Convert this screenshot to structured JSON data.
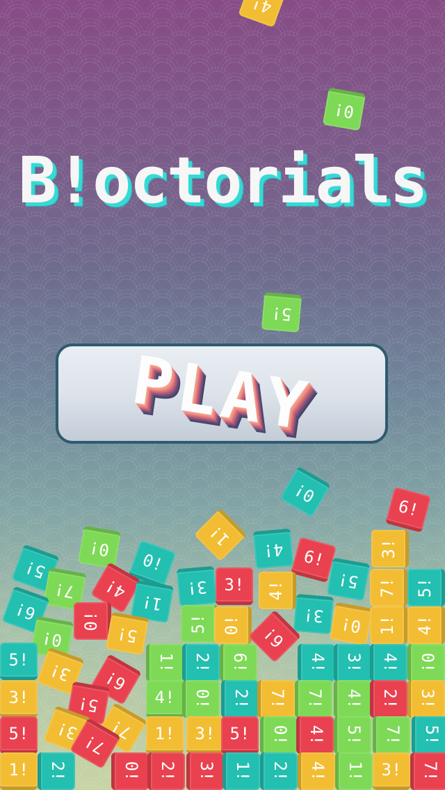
{
  "title": "B!octorials",
  "play_label": "PLAY",
  "colors": {
    "green": "#7ed957",
    "teal": "#23bfb1",
    "yellow": "#f2bd33",
    "red": "#e9414f",
    "play_border": "#2e5b6e"
  },
  "blocks": [
    {
      "label": "4!",
      "color": "green"
    },
    {
      "label": "0!",
      "color": "green"
    },
    {
      "label": "5!",
      "color": "green"
    },
    {
      "label": "0!",
      "color": "teal"
    },
    {
      "label": "6!",
      "color": "red"
    },
    {
      "label": "1!",
      "color": "yellow"
    },
    {
      "label": "0!",
      "color": "green"
    },
    {
      "label": "0!",
      "color": "teal"
    },
    {
      "label": "4!",
      "color": "teal"
    },
    {
      "label": "6!",
      "color": "red"
    },
    {
      "label": "3!",
      "color": "yellow"
    },
    {
      "label": "5!",
      "color": "teal"
    },
    {
      "label": "7!",
      "color": "green"
    },
    {
      "label": "4!",
      "color": "red"
    },
    {
      "label": "5!",
      "color": "teal"
    },
    {
      "label": "3!",
      "color": "teal"
    },
    {
      "label": "3!",
      "color": "red"
    },
    {
      "label": "4!",
      "color": "yellow"
    },
    {
      "label": "7!",
      "color": "yellow"
    },
    {
      "label": "5!",
      "color": "teal"
    },
    {
      "label": "6!",
      "color": "teal"
    },
    {
      "label": "1!",
      "color": "teal"
    },
    {
      "label": "0!",
      "color": "red"
    },
    {
      "label": "3!",
      "color": "teal"
    },
    {
      "label": "0!",
      "color": "yellow"
    },
    {
      "label": "1!",
      "color": "yellow"
    },
    {
      "label": "4!",
      "color": "yellow"
    },
    {
      "label": "0!",
      "color": "green"
    },
    {
      "label": "5!",
      "color": "yellow"
    },
    {
      "label": "5!",
      "color": "green"
    },
    {
      "label": "0!",
      "color": "yellow"
    },
    {
      "label": "6!",
      "color": "red"
    },
    {
      "label": "5!",
      "color": "teal"
    },
    {
      "label": "1!",
      "color": "green"
    },
    {
      "label": "2!",
      "color": "teal"
    },
    {
      "label": "6!",
      "color": "green"
    },
    {
      "label": "4!",
      "color": "teal"
    },
    {
      "label": "3!",
      "color": "teal"
    },
    {
      "label": "4!",
      "color": "teal"
    },
    {
      "label": "0!",
      "color": "green"
    },
    {
      "label": "3!",
      "color": "yellow"
    },
    {
      "label": "6!",
      "color": "red"
    },
    {
      "label": "4!",
      "color": "green"
    },
    {
      "label": "0!",
      "color": "green"
    },
    {
      "label": "2!",
      "color": "teal"
    },
    {
      "label": "7!",
      "color": "yellow"
    },
    {
      "label": "7!",
      "color": "green"
    },
    {
      "label": "4!",
      "color": "green"
    },
    {
      "label": "2!",
      "color": "red"
    },
    {
      "label": "3!",
      "color": "yellow"
    },
    {
      "label": "3!",
      "color": "yellow"
    },
    {
      "label": "5!",
      "color": "red"
    },
    {
      "label": "3!",
      "color": "yellow"
    },
    {
      "label": "7!",
      "color": "yellow"
    },
    {
      "label": "5!",
      "color": "red"
    },
    {
      "label": "1!",
      "color": "yellow"
    },
    {
      "label": "3!",
      "color": "yellow"
    },
    {
      "label": "5!",
      "color": "red"
    },
    {
      "label": "0!",
      "color": "green"
    },
    {
      "label": "4!",
      "color": "red"
    },
    {
      "label": "5!",
      "color": "green"
    },
    {
      "label": "7!",
      "color": "green"
    },
    {
      "label": "5!",
      "color": "teal"
    },
    {
      "label": "7!",
      "color": "red"
    },
    {
      "label": "1!",
      "color": "yellow"
    },
    {
      "label": "2!",
      "color": "teal"
    },
    {
      "label": "0!",
      "color": "red"
    },
    {
      "label": "2!",
      "color": "red"
    },
    {
      "label": "3!",
      "color": "red"
    },
    {
      "label": "1!",
      "color": "teal"
    },
    {
      "label": "2!",
      "color": "teal"
    },
    {
      "label": "4!",
      "color": "yellow"
    },
    {
      "label": "1!",
      "color": "green"
    },
    {
      "label": "3!",
      "color": "yellow"
    },
    {
      "label": "7!",
      "color": "red"
    },
    {
      "label": "4!",
      "color": "yellow"
    }
  ]
}
